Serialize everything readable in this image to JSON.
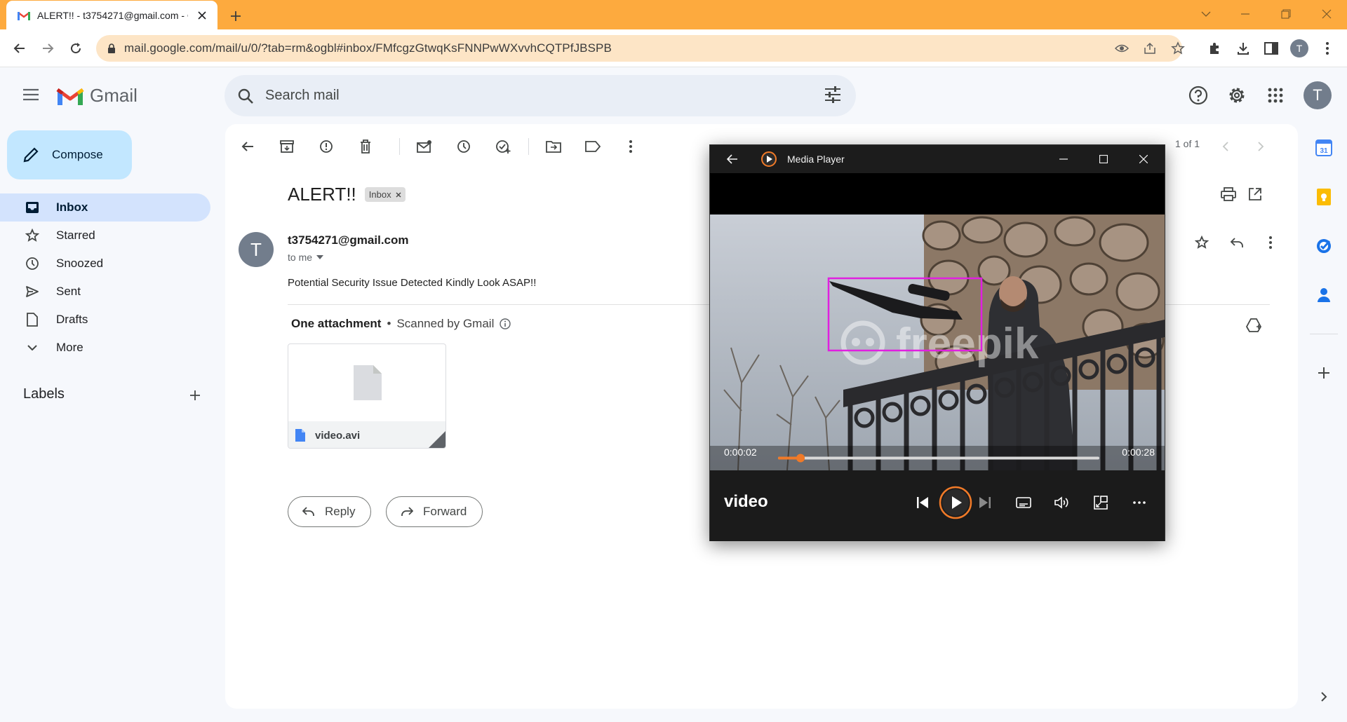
{
  "browser": {
    "tab_title": "ALERT!! - t3754271@gmail.com - Gmail",
    "url": "mail.google.com/mail/u/0/?tab=rm&ogbl#inbox/FMfcgzGtwqKsFNNPwWXvvhCQTPfJBSPB",
    "profile_initial": "T",
    "accent_color": "#fdaa3e"
  },
  "gmail": {
    "logo_text": "Gmail",
    "search_placeholder": "Search mail",
    "account_initial": "T",
    "compose_label": "Compose",
    "nav": [
      {
        "label": "Inbox",
        "icon": "inbox-icon",
        "active": true
      },
      {
        "label": "Starred",
        "icon": "star-icon"
      },
      {
        "label": "Snoozed",
        "icon": "clock-icon"
      },
      {
        "label": "Sent",
        "icon": "send-icon"
      },
      {
        "label": "Drafts",
        "icon": "draft-icon"
      },
      {
        "label": "More",
        "icon": "chevron-down-icon"
      }
    ],
    "labels_title": "Labels"
  },
  "message": {
    "pager": "1 of 1",
    "subject": "ALERT!!",
    "chip": "Inbox",
    "sender_initial": "T",
    "sender": "t3754271@gmail.com",
    "to": "to me",
    "body": "Potential Security Issue Detected Kindly Look ASAP!!",
    "attachment_header": "One attachment",
    "scanned": "Scanned by Gmail",
    "attachment_name": "video.avi",
    "reply_label": "Reply",
    "forward_label": "Forward"
  },
  "player": {
    "window_title": "Media Player",
    "elapsed": "0:00:02",
    "duration": "0:00:28",
    "progress": 0.07,
    "media_name": "video",
    "watermark": "freepik",
    "highlight_color": "#e020e0",
    "accent_color": "#f07a28"
  }
}
